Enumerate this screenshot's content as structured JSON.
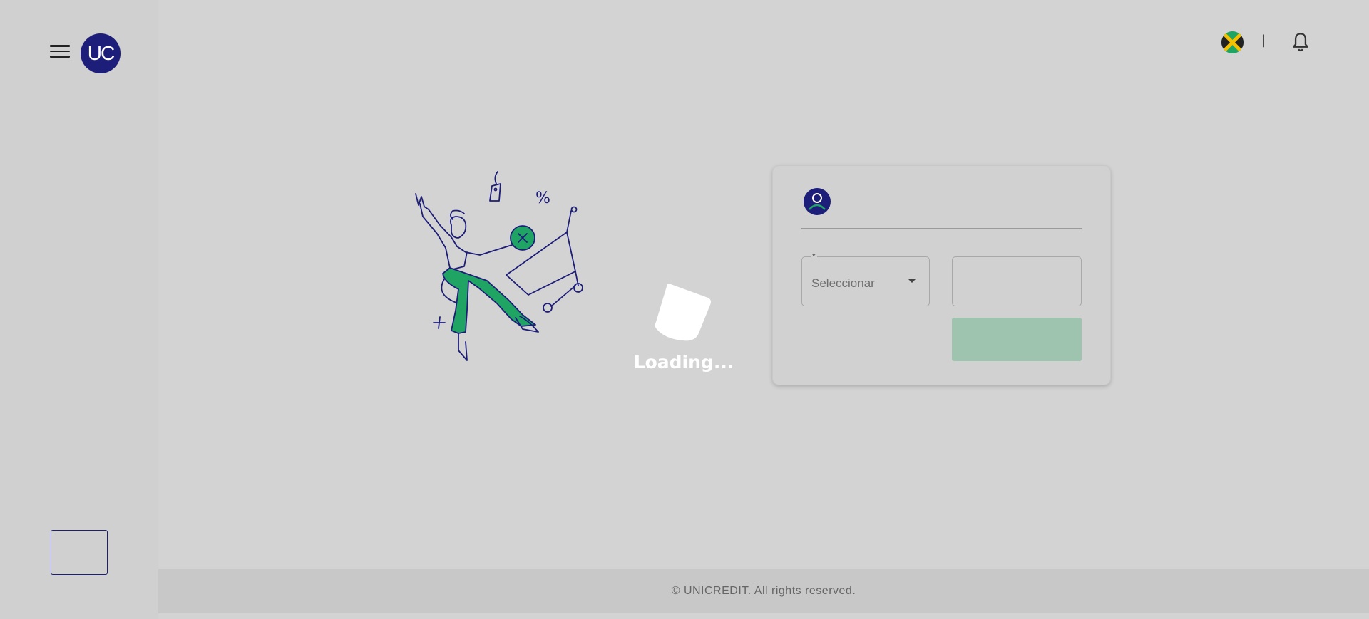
{
  "sidebar": {
    "menu_icon": "hamburger-menu-icon",
    "logo_text": "UC"
  },
  "topbar": {
    "flag_icon": "jamaica-flag-icon",
    "divider": "|",
    "bell_icon": "notification-bell-icon"
  },
  "loader": {
    "text": "Loading..."
  },
  "form": {
    "user_icon": "user-avatar-icon",
    "select": {
      "required_mark": "*",
      "value": "Seleccionar"
    },
    "input_value": "",
    "submit_label": ""
  },
  "footer": {
    "copyright": "© UNICREDIT. All rights reserved."
  },
  "colors": {
    "brand_navy": "#1d1d7a",
    "brand_green": "#1fa463",
    "overlay_gray": "#d3d3d3"
  }
}
